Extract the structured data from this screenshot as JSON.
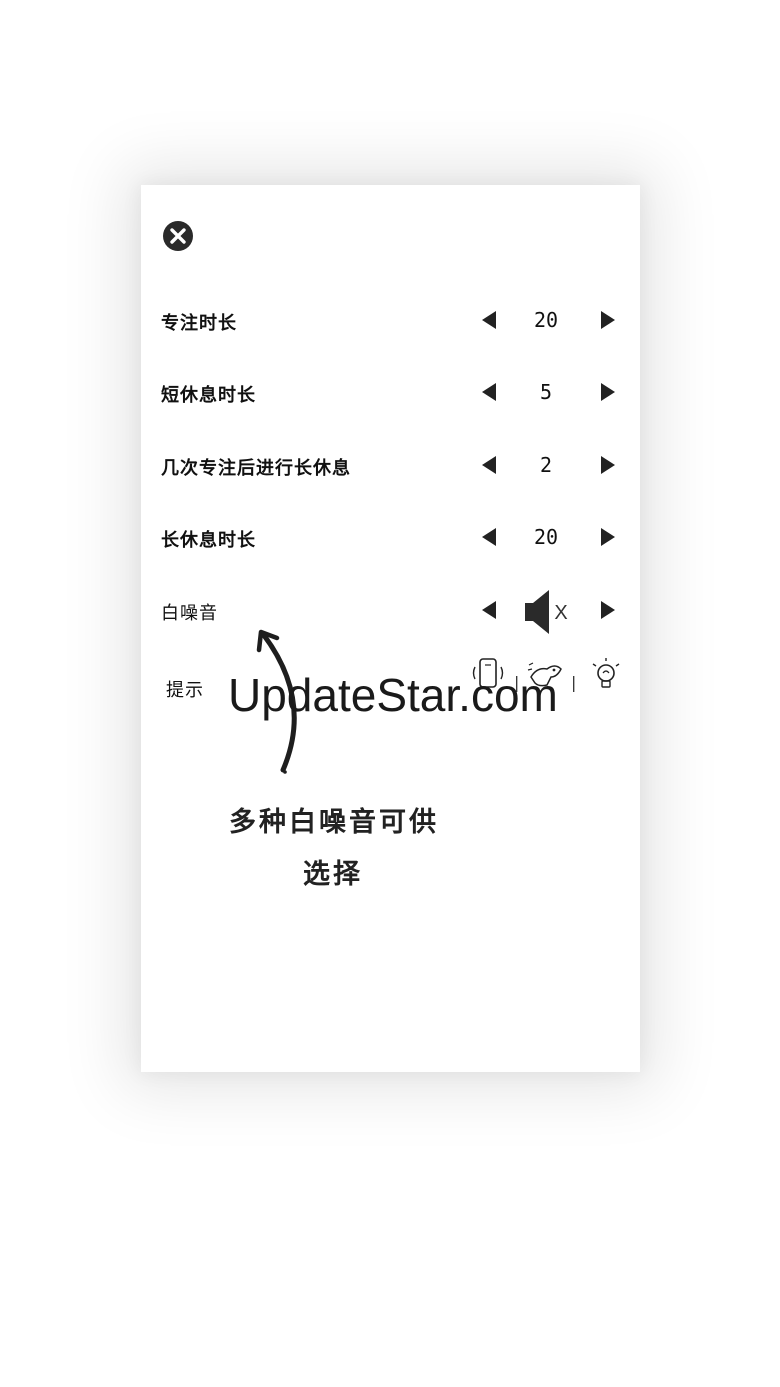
{
  "settings": {
    "rows": [
      {
        "label": "专注时长",
        "value": "20"
      },
      {
        "label": "短休息时长",
        "value": "5"
      },
      {
        "label": "几次专注后进行长休息",
        "value": "2"
      },
      {
        "label": "长休息时长",
        "value": "20"
      },
      {
        "label": "白噪音",
        "value": "X"
      }
    ],
    "reminder": {
      "label": "提示",
      "separator": "|",
      "icons": [
        "phone-vibrate-icon",
        "dog-icon",
        "lightbulb-icon"
      ]
    }
  },
  "watermark": "UpdateStar.com",
  "annotation": {
    "line1": "多种白噪音可供",
    "line2": "选择"
  },
  "colors": {
    "icon": "#2a2a2a",
    "text": "#111111"
  }
}
